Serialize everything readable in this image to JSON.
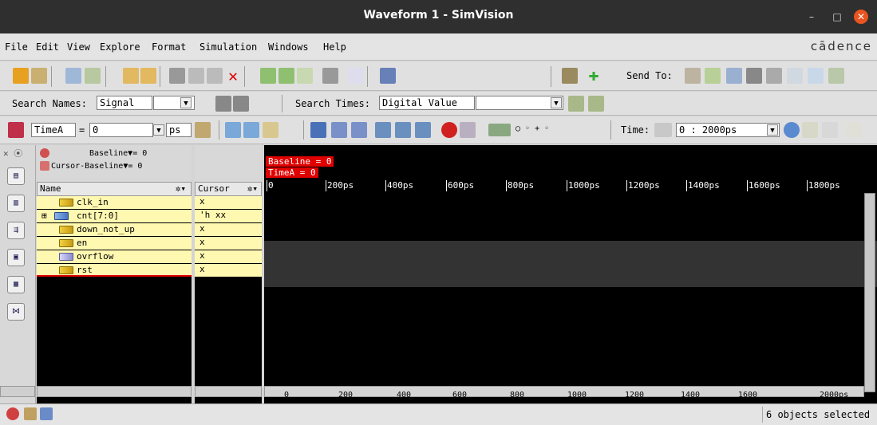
{
  "window": {
    "title": "Waveform 1 - SimVision",
    "minimize": "–",
    "maximize": "□",
    "close": "✕"
  },
  "menubar": {
    "items": [
      "File",
      "Edit",
      "View",
      "Explore",
      "Format",
      "Simulation",
      "Windows",
      "Help"
    ],
    "brand": "cādence"
  },
  "toolbar1": {
    "send_to_label": "Send To:"
  },
  "search": {
    "names_label": "Search Names:",
    "names_type": "Signal",
    "names_value": "",
    "times_label": "Search Times:",
    "times_type": "Digital Value",
    "times_value": ""
  },
  "toolbar3": {
    "cursor_name": "TimeA",
    "cursor_value": "0",
    "unit": "ps",
    "time_label": "Time:",
    "time_range": "0 : 2000ps"
  },
  "baseline": {
    "label": "Baseline",
    "value": "0",
    "cursor_baseline_label": "Cursor-Baseline",
    "cursor_baseline_value": "0"
  },
  "columns": {
    "name": "Name",
    "cursor": "Cursor"
  },
  "signals": [
    {
      "name": "clk_in",
      "value": "x"
    },
    {
      "name": "cnt[7:0]",
      "value": "'h xx"
    },
    {
      "name": "down_not_up",
      "value": "x"
    },
    {
      "name": "en",
      "value": "x"
    },
    {
      "name": "ovrflow",
      "value": "x"
    },
    {
      "name": "rst",
      "value": "x"
    }
  ],
  "wave_markers": {
    "baseline": "Baseline = 0",
    "timea": "TimeA = 0"
  },
  "ruler_top": [
    "0",
    "200ps",
    "400ps",
    "600ps",
    "800ps",
    "1000ps",
    "1200ps",
    "1400ps",
    "1600ps",
    "1800ps"
  ],
  "ruler_bottom": [
    "0",
    "200",
    "400",
    "600",
    "800",
    "1000",
    "1200",
    "1400",
    "1600",
    "2000ps"
  ],
  "status": {
    "message": "6 objects selected"
  },
  "colors": {
    "signal_row_bg": "#fff8b0",
    "marker_red": "#e00000",
    "waveform_bg": "#000000",
    "title_bg": "#2f2f2f"
  }
}
